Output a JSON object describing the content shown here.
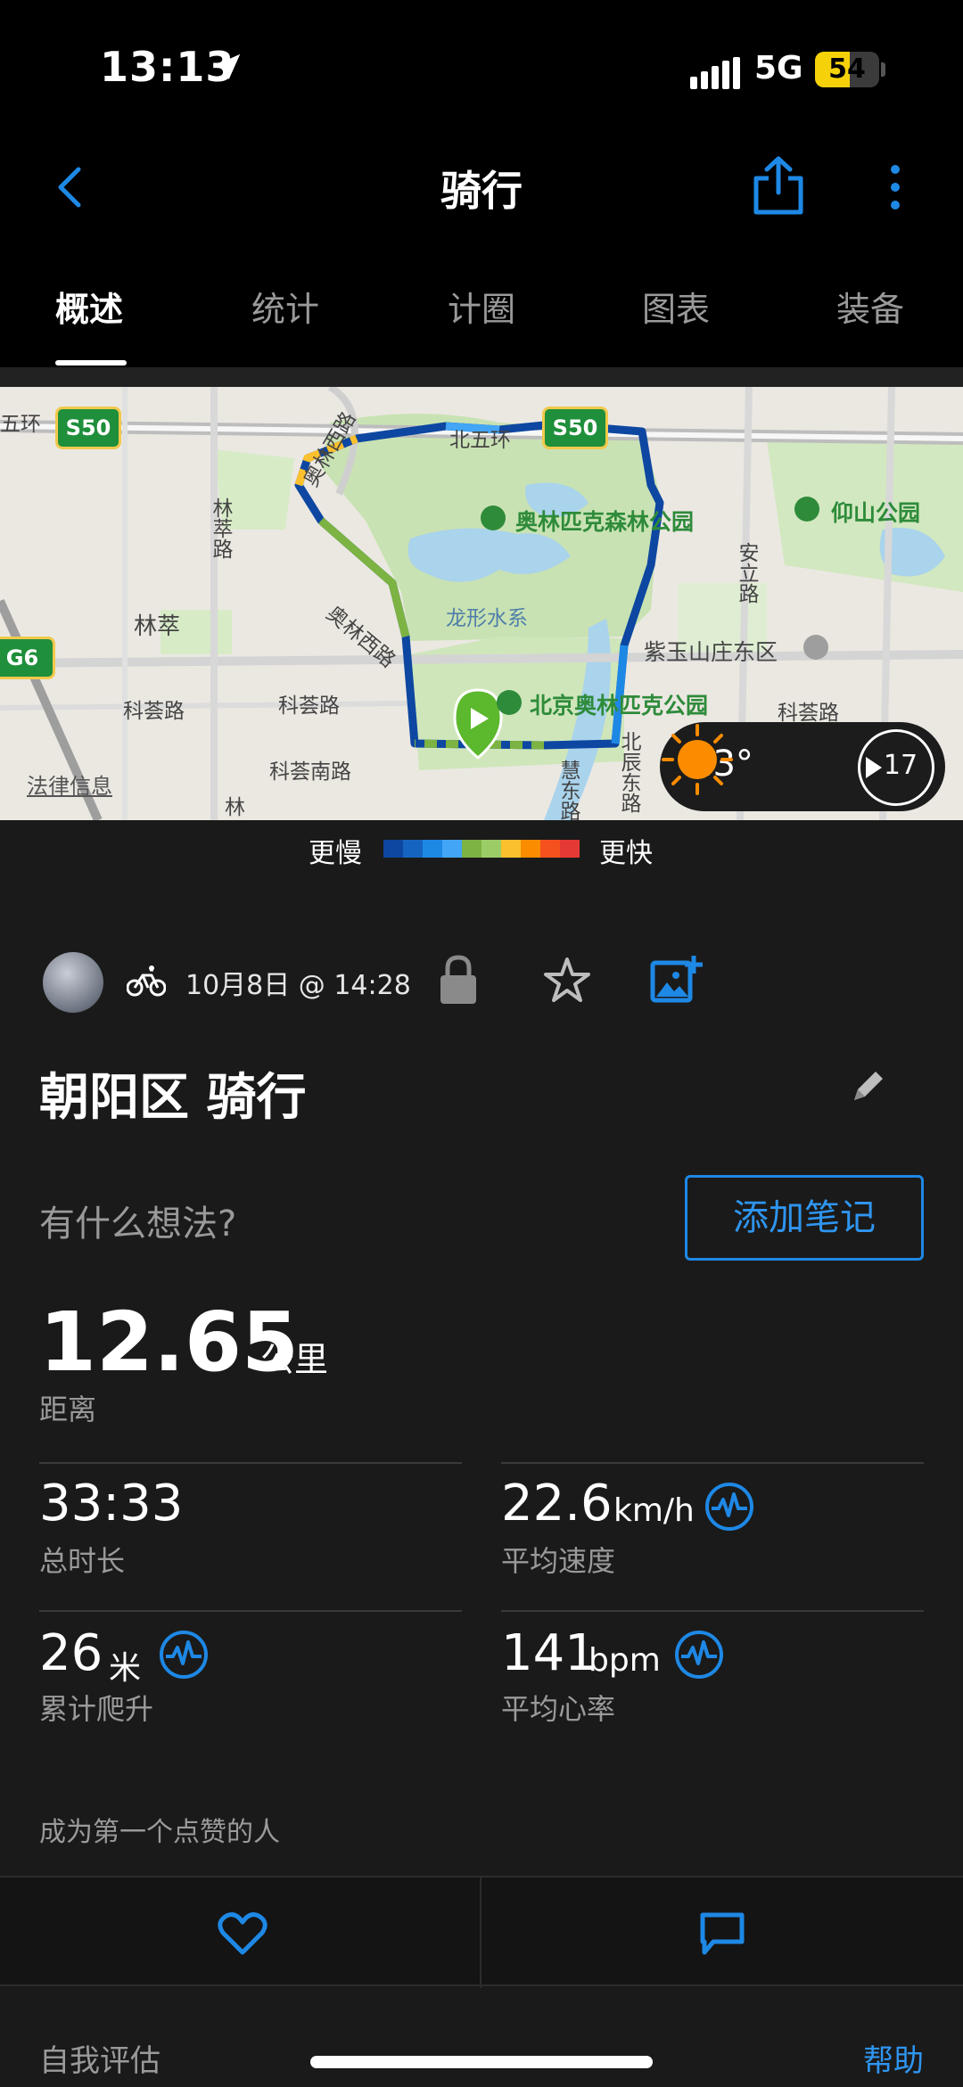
{
  "status": {
    "time": "13:13",
    "network": "5G",
    "battery": "54",
    "battery_level": 0.54
  },
  "nav": {
    "title": "骑行"
  },
  "tabs": [
    "概述",
    "统计",
    "计圈",
    "图表",
    "装备"
  ],
  "map": {
    "labels": {
      "s50_left": "S50",
      "s50_right": "S50",
      "g6": "G6",
      "wuhuan_left": "五环",
      "beiwuhuan": "北五环",
      "linsui": "林萃路",
      "olympic_west_top": "奥林西路",
      "olympic_west_mid": "奥林西路",
      "forest_park": "奥林匹克森林公园",
      "longxing": "龙形水系",
      "yangshan": "仰山公园",
      "anli": "安立路",
      "lincui": "林萃",
      "ziyu": "紫玉山庄东区",
      "kehui_left": "科荟路",
      "kehui_mid": "科荟路",
      "kehui_right": "科荟路",
      "olympic_park": "北京奥林匹克公园",
      "kehui_south": "科荟南路",
      "beichen": "北辰东路",
      "lin_bottom": "林",
      "hui_bottom": "慧东路",
      "legal": "法律信息"
    },
    "weather": {
      "temp": "23°",
      "wind": "17"
    },
    "legend": {
      "slow": "更慢",
      "fast": "更快",
      "colors": [
        "#0d47a1",
        "#1565c0",
        "#1e88e5",
        "#42a5f5",
        "#7cb342",
        "#9ccc65",
        "#fbc02d",
        "#fb8c00",
        "#f4511e",
        "#e53935"
      ]
    }
  },
  "meta": {
    "date": "10月8日 @ 14:28"
  },
  "activity": {
    "title": "朝阳区 骑行",
    "thoughts": "有什么想法?",
    "add_note": "添加笔记"
  },
  "stats": {
    "distance": {
      "value": "12.65",
      "unit": "公里",
      "label": "距离"
    },
    "duration": {
      "value": "33:33",
      "label": "总时长"
    },
    "speed": {
      "value": "22.6",
      "unit": "km/h",
      "label": "平均速度"
    },
    "ascent": {
      "value": "26",
      "unit": "米",
      "label": "累计爬升"
    },
    "heart_rate": {
      "value": "141",
      "unit": "bpm",
      "label": "平均心率"
    }
  },
  "social": {
    "likes": "成为第一个点赞的人"
  },
  "footer": {
    "self_eval": "自我评估",
    "help": "帮助"
  },
  "colors": {
    "accent": "#1e88e5",
    "background": "#1a1a1a",
    "route_start": "#5cb82d"
  }
}
